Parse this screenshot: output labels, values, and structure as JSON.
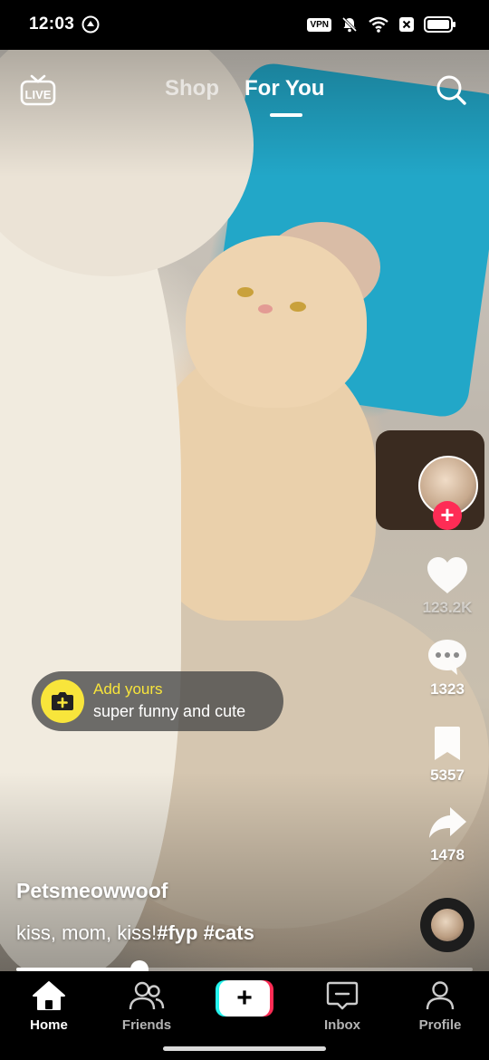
{
  "status_bar": {
    "time": "12:03",
    "vpn": "VPN",
    "icons": [
      "vpn-icon",
      "mute-icon",
      "wifi-icon",
      "sim-x-icon",
      "battery-icon"
    ]
  },
  "top_nav": {
    "live_icon": "live-tv-icon",
    "tabs": [
      {
        "label": "Shop",
        "active": false
      },
      {
        "label": "For You",
        "active": true
      }
    ],
    "search_icon": "search-icon"
  },
  "rail": {
    "likes": "123.2K",
    "comments": "1323",
    "saves": "5357",
    "shares": "1478"
  },
  "add_yours": {
    "title": "Add yours",
    "subtitle": "super funny and cute"
  },
  "post": {
    "username": "Petsmeowwoof",
    "caption_text": "kiss, mom, kiss!",
    "hashtags": "#fyp #cats"
  },
  "playback": {
    "progress_fraction": 0.27
  },
  "bottom_nav": {
    "items": [
      {
        "label": "Home",
        "icon": "home-icon",
        "active": true
      },
      {
        "label": "Friends",
        "icon": "friends-icon",
        "active": false
      },
      {
        "label": "",
        "icon": "create-plus-icon",
        "active": false
      },
      {
        "label": "Inbox",
        "icon": "inbox-icon",
        "active": false
      },
      {
        "label": "Profile",
        "icon": "profile-icon",
        "active": false
      }
    ]
  },
  "colors": {
    "accent_red": "#fe2c55",
    "accent_cyan": "#25f4ee",
    "add_yours_yellow": "#f8e53b"
  }
}
